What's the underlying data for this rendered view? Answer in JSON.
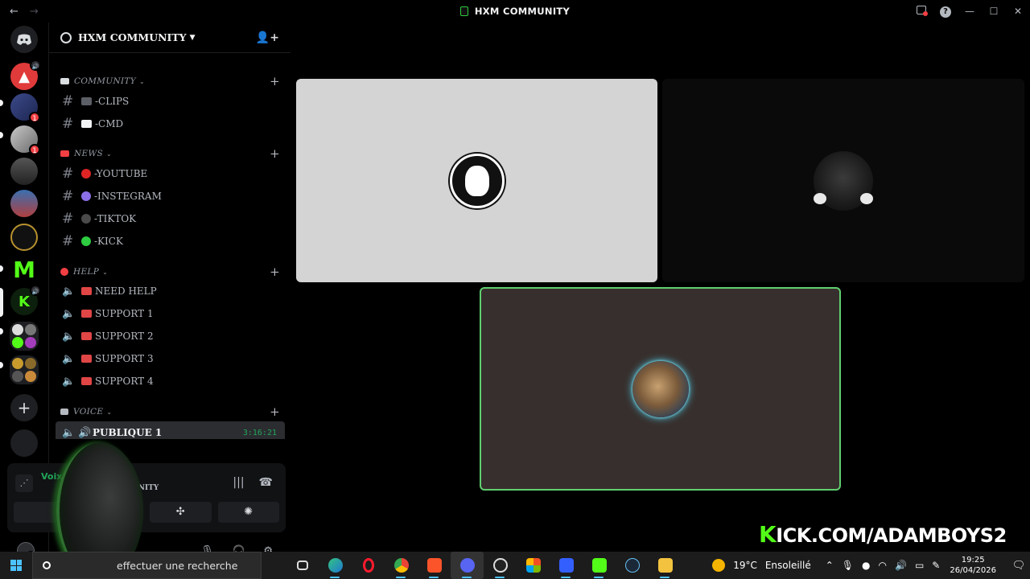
{
  "window": {
    "title": "HXM COMMUNITY",
    "back_icon": "←",
    "forward_icon": "→",
    "min": "—",
    "max": "☐",
    "close": "✕"
  },
  "server_rail": {
    "badges": [
      "1",
      "1"
    ]
  },
  "guild": {
    "name": "HXM COMMUNITY",
    "categories": {
      "community": "COMMUNITY",
      "news": "NEWS",
      "help": "HELP",
      "voice": "VOICE"
    },
    "channels": {
      "clips": "-CLIPS",
      "cmd": "-CMD",
      "youtube": "-YOUTUBE",
      "instegram": "-INSTEGRAM",
      "tiktok": "-TIKTOK",
      "kick": "-KICK",
      "need_help": "NEED HELP",
      "support1": "SUPPORT 1",
      "support2": "SUPPORT 2",
      "support3": "SUPPORT 3",
      "support4": "SUPPORT 4",
      "publique1": "PUBLIQUE 1"
    },
    "publique1_timer": "3:16:21"
  },
  "voice_panel": {
    "status": "Voix",
    "server": "COMMUNITY"
  },
  "stream_overlay": {
    "url_k": "K",
    "url_rest": "ICK.COM/ADAMBOYS2"
  },
  "taskbar": {
    "search_placeholder": "effectuer une recherche",
    "weather": "19°C",
    "weather_desc": "Ensoleillé",
    "time": "19:25",
    "date": "26/04/2026"
  },
  "colors": {
    "accent_green": "#23a55a",
    "kick_green": "#53fc18",
    "speaking_border": "#5fcf6f"
  }
}
